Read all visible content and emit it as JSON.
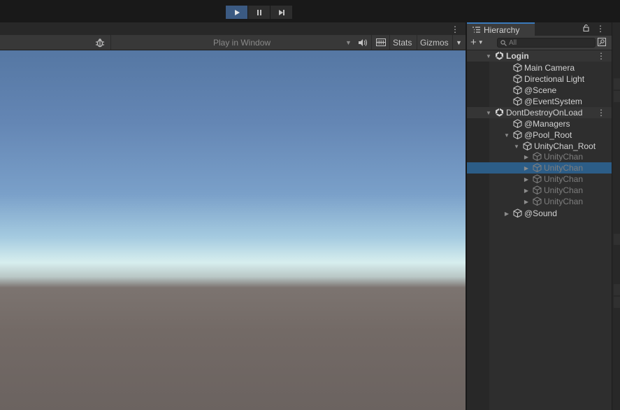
{
  "toolbar": {
    "play_icon": "play-icon",
    "pause_icon": "pause-icon",
    "step_icon": "step-icon",
    "accent": "#3b5a82"
  },
  "game_view": {
    "display_select": "Play in Window",
    "stats_label": "Stats",
    "gizmos_label": "Gizmos"
  },
  "hierarchy": {
    "tab_label": "Hierarchy",
    "search_placeholder": "All",
    "rows": [
      {
        "label": "Login",
        "type": "scene"
      },
      {
        "label": "Main Camera"
      },
      {
        "label": "Directional Light"
      },
      {
        "label": "@Scene"
      },
      {
        "label": "@EventSystem"
      },
      {
        "label": "DontDestroyOnLoad",
        "type": "scene"
      },
      {
        "label": "@Managers"
      },
      {
        "label": "@Pool_Root"
      },
      {
        "label": "UnityChan_Root"
      },
      {
        "label": "UnityChan",
        "inactive": true
      },
      {
        "label": "UnityChan",
        "inactive": true,
        "selected": true
      },
      {
        "label": "UnityChan",
        "inactive": true
      },
      {
        "label": "UnityChan",
        "inactive": true
      },
      {
        "label": "UnityChan",
        "inactive": true
      },
      {
        "label": "@Sound"
      }
    ],
    "selection_color": "#2c5d87"
  }
}
